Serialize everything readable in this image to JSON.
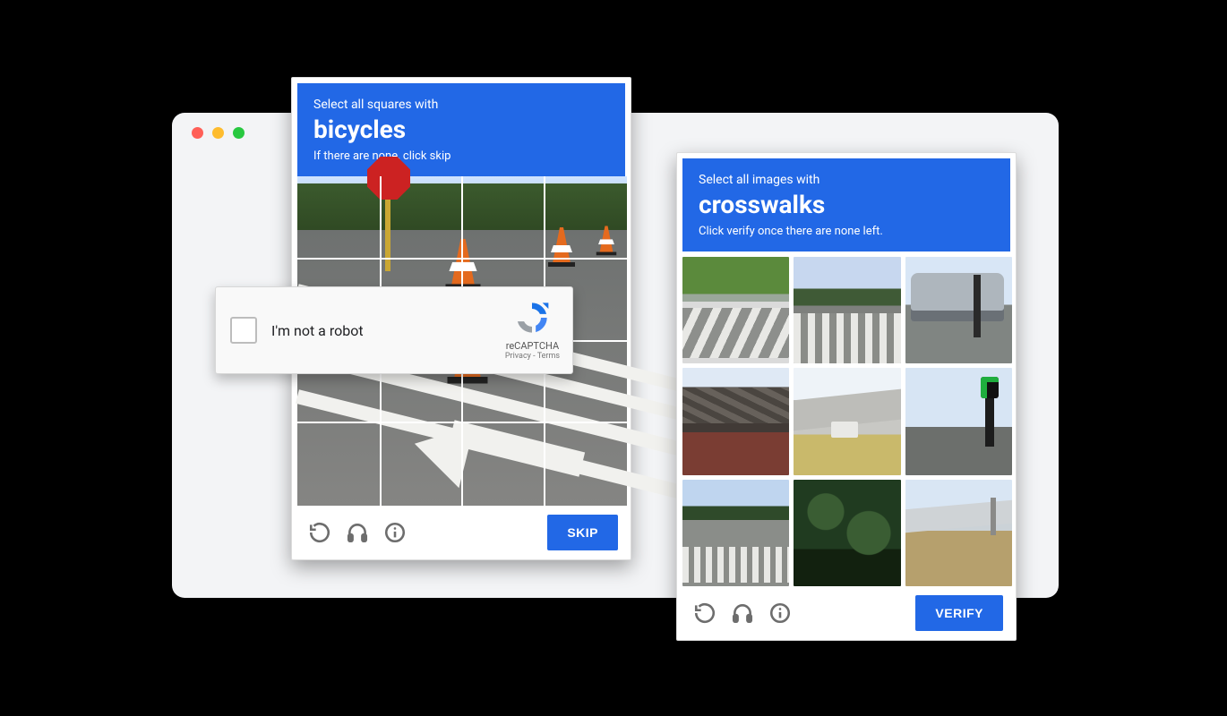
{
  "captcha_left": {
    "header_pre": "Select all squares with",
    "header_target": "bicycles",
    "header_post": "If there are none, click skip",
    "grid_size": "4x4",
    "grid_cells": 16,
    "action_label": "SKIP"
  },
  "captcha_right": {
    "header_pre": "Select all images with",
    "header_target": "crosswalks",
    "header_post": "Click verify once there are none left.",
    "grid_size": "3x3",
    "grid_cells": 9,
    "action_label": "VERIFY"
  },
  "footer_icons": {
    "reload": "reload-icon",
    "audio": "headphones-icon",
    "info": "info-icon"
  },
  "anchor_widget": {
    "label": "I'm not a robot",
    "brand": "reCAPTCHA",
    "privacy": "Privacy",
    "terms": "Terms",
    "link_separator": " - "
  },
  "colors": {
    "captcha_blue": "#2268e6",
    "window_bg": "#f3f4f6"
  }
}
